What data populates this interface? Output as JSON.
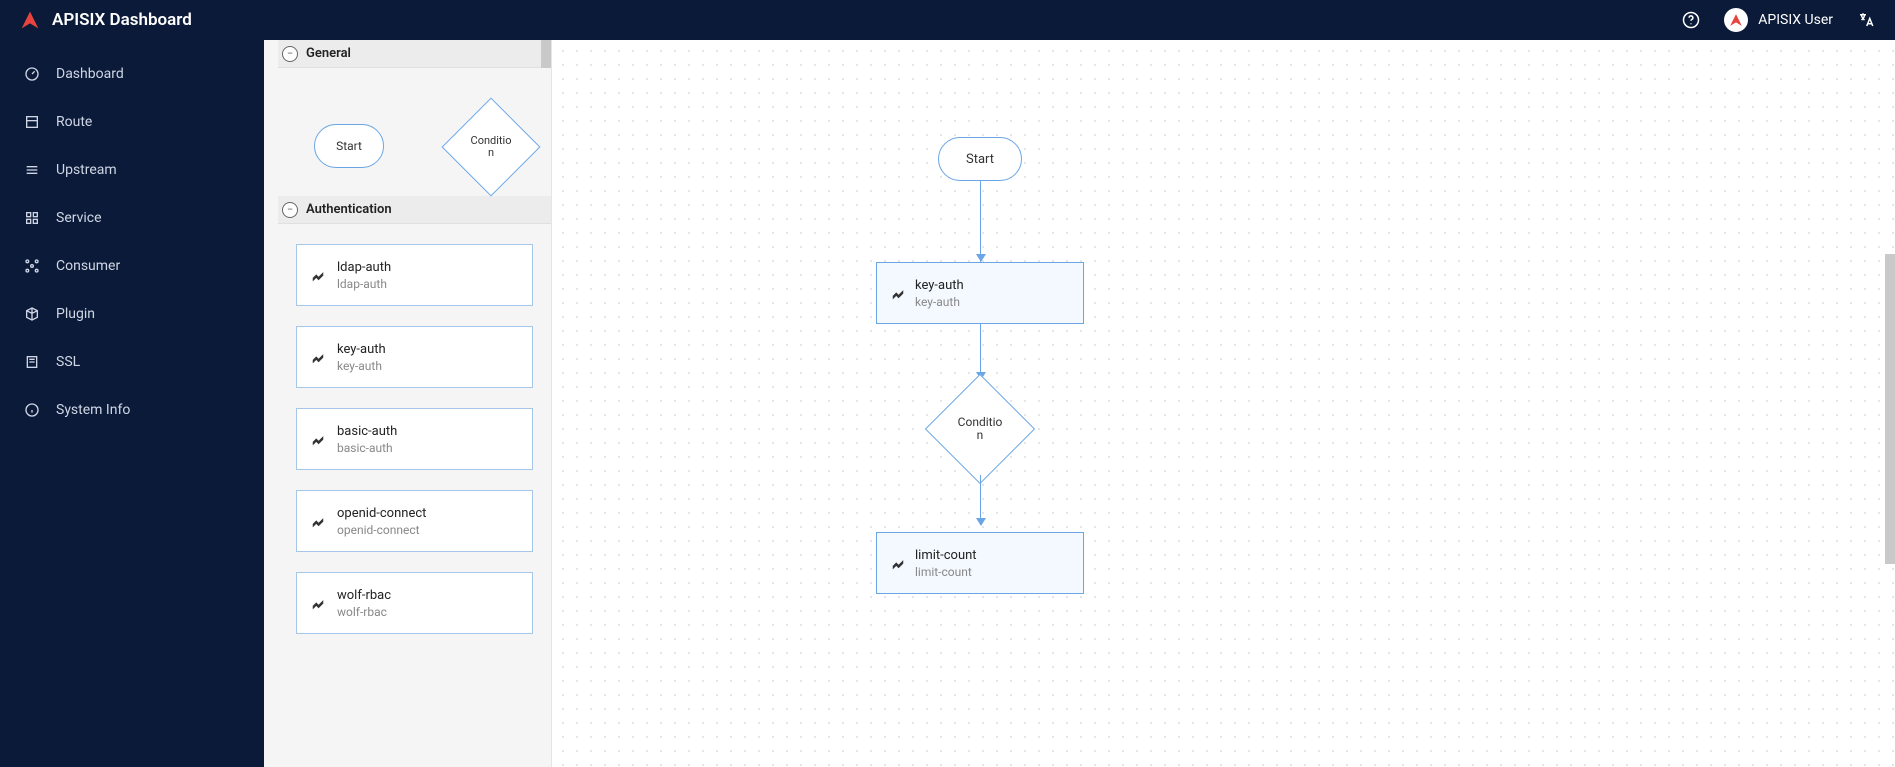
{
  "header": {
    "title": "APISIX Dashboard",
    "user": "APISIX User"
  },
  "sidebar": {
    "items": [
      {
        "label": "Dashboard"
      },
      {
        "label": "Route"
      },
      {
        "label": "Upstream"
      },
      {
        "label": "Service"
      },
      {
        "label": "Consumer"
      },
      {
        "label": "Plugin"
      },
      {
        "label": "SSL"
      },
      {
        "label": "System Info"
      }
    ]
  },
  "palette": {
    "sections": [
      {
        "title": "General",
        "shapes": [
          {
            "label": "Start"
          },
          {
            "label": "Conditio\nn"
          }
        ]
      },
      {
        "title": "Authentication",
        "plugins": [
          {
            "title": "ldap-auth",
            "sub": "ldap-auth"
          },
          {
            "title": "key-auth",
            "sub": "key-auth"
          },
          {
            "title": "basic-auth",
            "sub": "basic-auth"
          },
          {
            "title": "openid-connect",
            "sub": "openid-connect"
          },
          {
            "title": "wolf-rbac",
            "sub": "wolf-rbac"
          }
        ]
      }
    ]
  },
  "canvas": {
    "nodes": [
      {
        "type": "start",
        "label": "Start"
      },
      {
        "type": "plugin",
        "title": "key-auth",
        "sub": "key-auth"
      },
      {
        "type": "condition",
        "label": "Conditio\nn"
      },
      {
        "type": "plugin",
        "title": "limit-count",
        "sub": "limit-count"
      }
    ]
  },
  "colors": {
    "headerBg": "#0a1a38",
    "nodeBorder": "#6aa6e6",
    "nodeFill": "#f4f9ff",
    "accentRed": "#E8433E"
  }
}
